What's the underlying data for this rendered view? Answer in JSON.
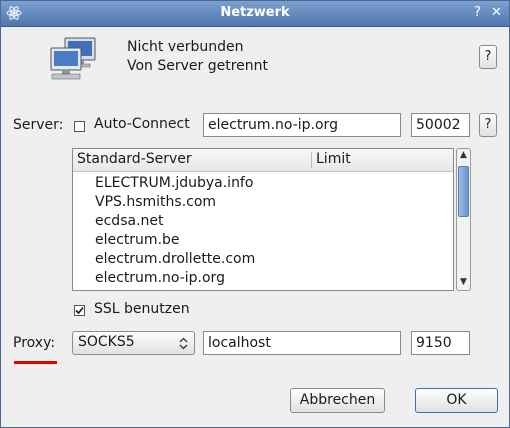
{
  "window": {
    "title": "Netzwerk",
    "help_glyph": "?",
    "close_glyph": "✕"
  },
  "status": {
    "line1": "Nicht verbunden",
    "line2": "Von Server getrennt",
    "help_label": "?"
  },
  "server": {
    "label": "Server:",
    "auto_connect_label": "Auto-Connect",
    "auto_connect_checked": false,
    "host": "electrum.no-ip.org",
    "port": "50002",
    "help_label": "?"
  },
  "server_list": {
    "columns": [
      "Standard-Server",
      "Limit"
    ],
    "rows": [
      "ELECTRUM.jdubya.info",
      "VPS.hsmiths.com",
      "ecdsa.net",
      "electrum.be",
      "electrum.drollette.com",
      "electrum.no-ip.org"
    ]
  },
  "ssl": {
    "label": "SSL benutzen",
    "checked": true
  },
  "proxy": {
    "label": "Proxy:",
    "type": "SOCKS5",
    "host": "localhost",
    "port": "9150"
  },
  "buttons": {
    "cancel": "Abbrechen",
    "ok": "OK"
  }
}
